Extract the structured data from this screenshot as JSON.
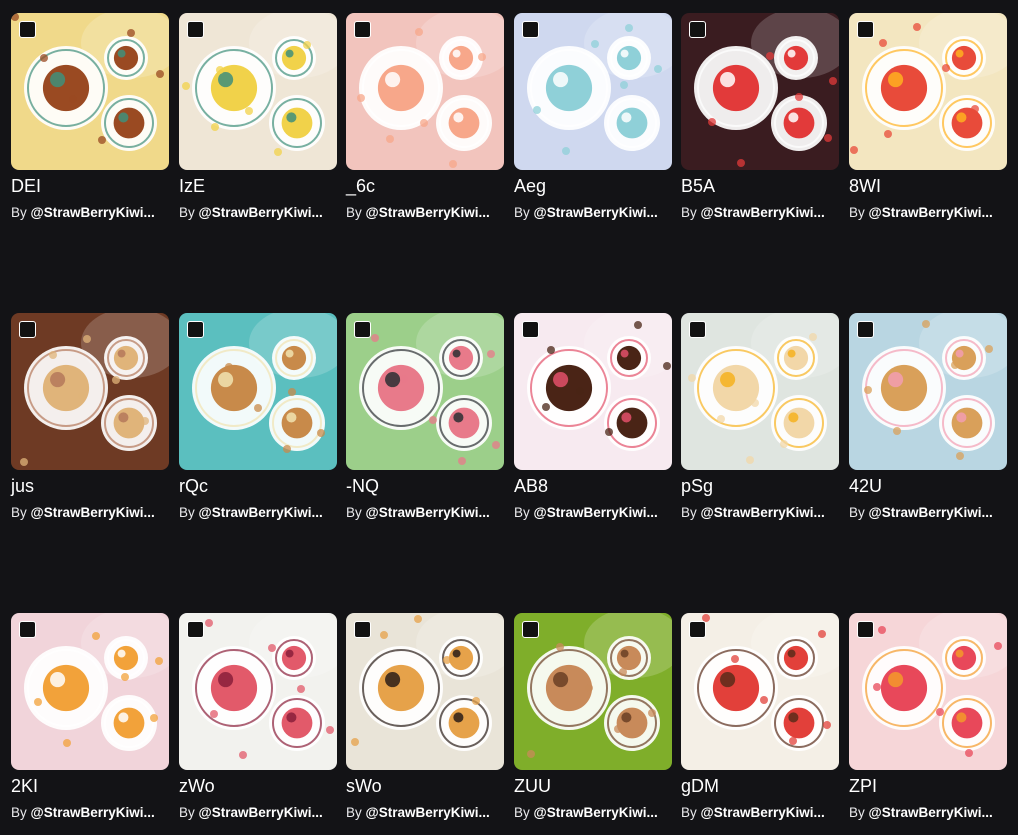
{
  "gallery": {
    "by_prefix": "By",
    "items": [
      {
        "title": "DEI",
        "author": "@StrawBerryKiwi...",
        "image": "french-toast-breakfast-checkered-plate",
        "bg": "#f0d98a",
        "accent": "#3f8f7a",
        "food": "#9a4a22"
      },
      {
        "title": "IzE",
        "author": "@StrawBerryKiwi...",
        "image": "scrambled-eggs-toast-breakfast",
        "bg": "#efe6d6",
        "accent": "#3f8f7a",
        "food": "#f1d24a"
      },
      {
        "title": "_6c",
        "author": "@StrawBerryKiwi...",
        "image": "peach-cakes-parfait-dessert-table",
        "bg": "#f2c4bd",
        "accent": "#ffffff",
        "food": "#f7a78a"
      },
      {
        "title": "Aeg",
        "author": "@StrawBerryKiwi...",
        "image": "pastel-mousse-cakes-on-stands",
        "bg": "#cfd8ef",
        "accent": "#ffffff",
        "food": "#8fd0d8"
      },
      {
        "title": "B5A",
        "author": "@StrawBerryKiwi...",
        "image": "fruit-parfait-glasses-dark-background",
        "bg": "#3a1c20",
        "accent": "#ffffff",
        "food": "#e23a3a"
      },
      {
        "title": "8WI",
        "author": "@StrawBerryKiwi...",
        "image": "fruit-tarts-grid-colorful",
        "bg": "#f3e6c0",
        "accent": "#ffb020",
        "food": "#e84b3a"
      },
      {
        "title": "jus",
        "author": "@StrawBerryKiwi...",
        "image": "nut-donuts-on-wooden-stands",
        "bg": "#6e3a24",
        "accent": "#b4785a",
        "food": "#e0b47a"
      },
      {
        "title": "rQc",
        "author": "@StrawBerryKiwi...",
        "image": "afternoon-tea-spread-pastries",
        "bg": "#5bbfbf",
        "accent": "#f1e3b0",
        "food": "#c88a4a"
      },
      {
        "title": "-NQ",
        "author": "@StrawBerryKiwi...",
        "image": "green-dessert-tower-tiered-stand",
        "bg": "#9ccf8a",
        "accent": "#2b2f33",
        "food": "#e87a8a"
      },
      {
        "title": "AB8",
        "author": "@StrawBerryKiwi...",
        "image": "chocolate-donut-strawberry-plate",
        "bg": "#f7eaf0",
        "accent": "#e2506a",
        "food": "#4a2416"
      },
      {
        "title": "pSg",
        "author": "@StrawBerryKiwi...",
        "image": "layer-cake-orange-drink-table",
        "bg": "#dfe5e0",
        "accent": "#f6b21f",
        "food": "#f2d7a8"
      },
      {
        "title": "42U",
        "author": "@StrawBerryKiwi...",
        "image": "decorated-cookies-pastel-plates",
        "bg": "#b9d6e2",
        "accent": "#f29eb2",
        "food": "#d9a05a"
      },
      {
        "title": "2KI",
        "author": "@StrawBerryKiwi...",
        "image": "fruit-cakes-pudding-pink-background",
        "bg": "#f1d4da",
        "accent": "#ffffff",
        "food": "#f2a23a"
      },
      {
        "title": "zWo",
        "author": "@StrawBerryKiwi...",
        "image": "smoothie-bowls-white-table",
        "bg": "#f2f2ee",
        "accent": "#8a1f3a",
        "food": "#e25a6a"
      },
      {
        "title": "sWo",
        "author": "@StrawBerryKiwi...",
        "image": "pancakes-coffee-breakfast-table",
        "bg": "#e9e4d8",
        "accent": "#2a1d18",
        "food": "#e6a24a"
      },
      {
        "title": "ZUU",
        "author": "@StrawBerryKiwi...",
        "image": "sandwiches-basket-picnic",
        "bg": "#7fae2a",
        "accent": "#6a3e24",
        "food": "#c88a5a"
      },
      {
        "title": "gDM",
        "author": "@StrawBerryKiwi...",
        "image": "chocolate-dessert-fruit-bowls",
        "bg": "#f4efe6",
        "accent": "#5a2c1a",
        "food": "#e2403a"
      },
      {
        "title": "ZPI",
        "author": "@StrawBerryKiwi...",
        "image": "strawberry-tarts-tea-pink-table",
        "bg": "#f6d6d8",
        "accent": "#f39a2a",
        "food": "#e8485a"
      }
    ]
  }
}
